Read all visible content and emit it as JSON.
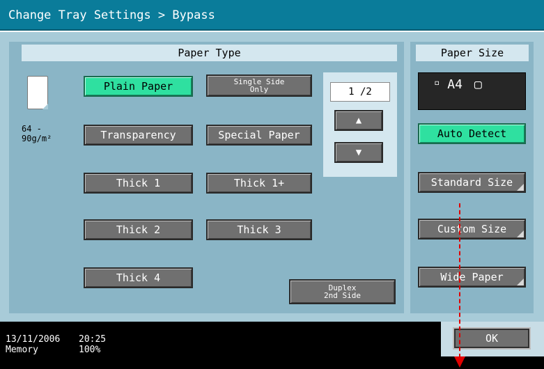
{
  "title": "Change Tray Settings > Bypass",
  "paper_type": {
    "header": "Paper Type",
    "buttons": {
      "plain_paper": "Plain Paper",
      "single_side_line1": "Single Side",
      "single_side_line2": "Only",
      "transparency": "Transparency",
      "special_paper": "Special Paper",
      "thick1": "Thick 1",
      "thick1plus": "Thick 1+",
      "thick2": "Thick 2",
      "thick3": "Thick 3",
      "thick4": "Thick 4",
      "duplex_line1": "Duplex",
      "duplex_line2": "2nd Side"
    },
    "selected": "Plain Paper",
    "weight_line1": "64  -",
    "weight_line2": "90g/m²",
    "page": "1 /2",
    "page_up": "▲",
    "page_down": "▼"
  },
  "paper_size": {
    "header": "Paper Size",
    "current": "A4",
    "current_icon": "▫",
    "orientation_icon": "▢",
    "buttons": {
      "auto_detect": "Auto Detect",
      "standard_size": "Standard Size",
      "custom_size": "Custom Size",
      "wide_paper": "Wide Paper"
    },
    "selected": "Auto Detect"
  },
  "status": {
    "date": "13/11/2006",
    "time": "20:25",
    "memory_label": "Memory",
    "memory_value": "100%"
  },
  "ok": "OK",
  "colors": {
    "title_bg": "#0a7c9a",
    "selected_button": "#2fe0a0",
    "annotation": "#e00000"
  }
}
